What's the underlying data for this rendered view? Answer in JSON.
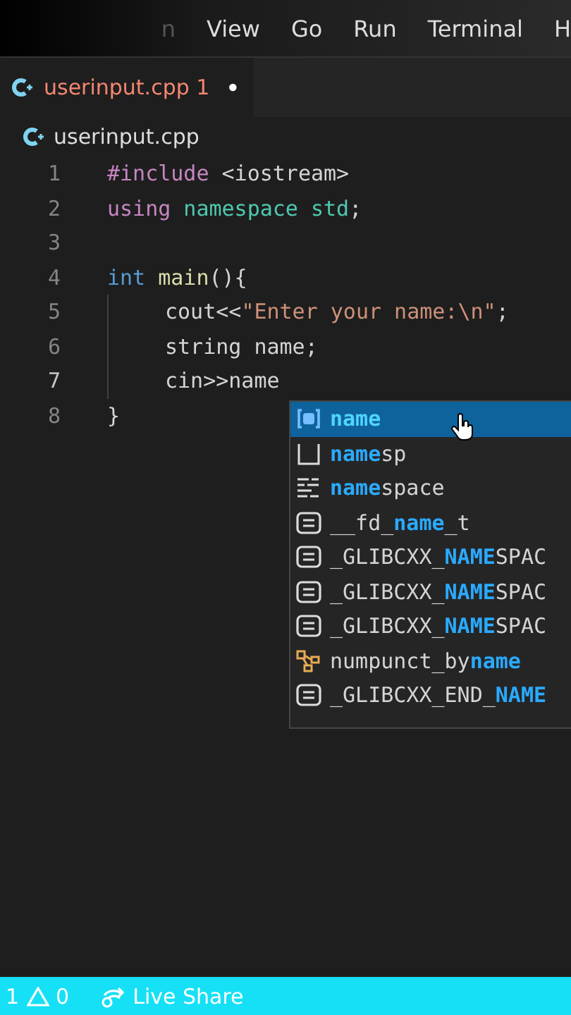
{
  "menu_bar": {
    "items": [
      "n",
      "View",
      "Go",
      "Run",
      "Terminal",
      "H"
    ]
  },
  "tabs": [
    {
      "label": "userinput.cpp 1",
      "selected": true,
      "modified": true,
      "has_errors": true
    }
  ],
  "breadcrumb": {
    "label": "userinput.cpp"
  },
  "editor": {
    "lines": [
      {
        "number": "1",
        "kind": "top",
        "tokens": [
          {
            "kind": "keyword",
            "text": "#include"
          },
          {
            "kind": "plain",
            "text": " <iostream>"
          }
        ]
      },
      {
        "number": "2",
        "kind": "top",
        "tokens": [
          {
            "kind": "keyword",
            "text": "using"
          },
          {
            "kind": "namespace",
            "text": " namespace"
          },
          {
            "kind": "namespace",
            "text": " std"
          },
          {
            "kind": "plain",
            "text": ";"
          }
        ]
      },
      {
        "number": "3",
        "kind": "top"
      },
      {
        "number": "4",
        "kind": "top",
        "tokens": [
          {
            "kind": "type",
            "text": "int"
          },
          {
            "kind": "function",
            "text": " main"
          },
          {
            "kind": "plain",
            "text": "(){"
          }
        ]
      },
      {
        "number": "5",
        "kind": "body",
        "tokens": [
          {
            "kind": "plain",
            "text": "cout<<"
          },
          {
            "kind": "string",
            "text": "\"Enter your name:\\n\""
          },
          {
            "kind": "plain",
            "text": ";"
          }
        ]
      },
      {
        "number": "6",
        "kind": "body",
        "tokens": [
          {
            "kind": "plain",
            "text": "string name;"
          }
        ]
      },
      {
        "number": "7",
        "kind": "body",
        "tokens": [
          {
            "kind": "plain",
            "text": "cin>>name"
          }
        ]
      },
      {
        "number": "8",
        "kind": "top",
        "tokens": [
          {
            "kind": "plain",
            "text": "}"
          }
        ]
      }
    ]
  },
  "suggestions": [
    {
      "kind": "variable",
      "selected": true,
      "parts": [
        {
          "text": "name",
          "match": true
        }
      ]
    },
    {
      "kind": "snippet",
      "selected": false,
      "parts": [
        {
          "text": "name",
          "match": true
        },
        {
          "text": "sp",
          "match": false
        }
      ]
    },
    {
      "kind": "keyword",
      "selected": false,
      "parts": [
        {
          "text": "name",
          "match": true
        },
        {
          "text": "space",
          "match": false
        }
      ]
    },
    {
      "kind": "field",
      "selected": false,
      "parts": [
        {
          "text": "__fd_",
          "match": false
        },
        {
          "text": "name",
          "match": true
        },
        {
          "text": "_t",
          "match": false
        }
      ]
    },
    {
      "kind": "field",
      "selected": false,
      "parts": [
        {
          "text": "_GLIBCXX_",
          "match": false
        },
        {
          "text": "NAME",
          "match": true
        },
        {
          "text": "SPAC",
          "match": false
        }
      ]
    },
    {
      "kind": "field",
      "selected": false,
      "parts": [
        {
          "text": "_GLIBCXX_",
          "match": false
        },
        {
          "text": "NAME",
          "match": true
        },
        {
          "text": "SPAC",
          "match": false
        }
      ]
    },
    {
      "kind": "field",
      "selected": false,
      "parts": [
        {
          "text": "_GLIBCXX_",
          "match": false
        },
        {
          "text": "NAME",
          "match": true
        },
        {
          "text": "SPAC",
          "match": false
        }
      ]
    },
    {
      "kind": "class",
      "selected": false,
      "parts": [
        {
          "text": "numpunct_by",
          "match": false
        },
        {
          "text": "name",
          "match": true
        }
      ]
    },
    {
      "kind": "field",
      "selected": false,
      "parts": [
        {
          "text": "_GLIBCXX_END_",
          "match": false
        },
        {
          "text": "NAME",
          "match": true
        }
      ]
    }
  ],
  "status_bar": {
    "errors": "1",
    "warnings": "0",
    "live_share": "Live Share"
  }
}
